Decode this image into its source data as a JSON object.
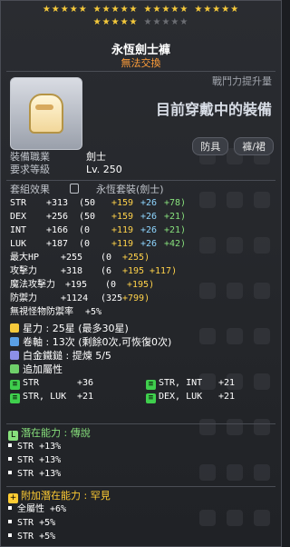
{
  "header": {
    "title": "永恆劍士褲",
    "subtitle": "無法交換",
    "power_label": "戰鬥力提升量",
    "wearing_label": "目前穿戴中的裝備",
    "tags": [
      "防具",
      "褲/裙"
    ]
  },
  "stars": {
    "filled": 25,
    "max": 30
  },
  "info": [
    {
      "key": "裝備職業",
      "value": "劍士"
    },
    {
      "key": "要求等級",
      "value": "Lv. 250"
    }
  ],
  "set": {
    "label": "套組效果",
    "name": "永恆套裝(劍士)"
  },
  "stats": [
    {
      "name": "STR",
      "total": "+313",
      "base": "(50",
      "star": "+159",
      "pot": "+26",
      "flame": "+78)"
    },
    {
      "name": "DEX",
      "total": "+256",
      "base": "(50",
      "star": "+159",
      "pot": "+26",
      "flame": "+21)"
    },
    {
      "name": "INT",
      "total": "+166",
      "base": "(0",
      "star": "+119",
      "pot": "+26",
      "flame": "+21)"
    },
    {
      "name": "LUK",
      "total": "+187",
      "base": "(0",
      "star": "+119",
      "pot": "+26",
      "flame": "+42)"
    }
  ],
  "stats2": [
    {
      "name": "最大HP",
      "total": "+255",
      "detail_a": "(0",
      "detail_b": "+255)"
    },
    {
      "name": "攻擊力",
      "total": "+318",
      "detail_a": "(6",
      "detail_b": "+195",
      "detail_c": "+117)"
    },
    {
      "name": "魔法攻擊力",
      "total": "+195",
      "detail_a": "(0",
      "detail_b": "+195)"
    },
    {
      "name": "防禦力",
      "total": "+1124",
      "detail_a": "(325",
      "detail_b": "+799)"
    },
    {
      "name": "無視怪物防禦率",
      "total": "+5%"
    }
  ],
  "enhance": [
    {
      "icon": "star-icon",
      "text": "星力 : 25星 (最多30星)"
    },
    {
      "icon": "scroll-icon",
      "text": "卷軸 : 13次 (剩餘0次,可恢復0次)"
    },
    {
      "icon": "hammer-icon",
      "text": "白金鐵鎚 : 提煉 5/5"
    },
    {
      "icon": "leaf-icon",
      "text": "追加屬性"
    }
  ],
  "additional_attrs": [
    {
      "label": "STR",
      "value": "+36"
    },
    {
      "label": "STR, INT",
      "value": "+21"
    },
    {
      "label": "STR, LUK",
      "value": "+21"
    },
    {
      "label": "DEX, LUK",
      "value": "+21"
    }
  ],
  "potential": {
    "title": "潛在能力 : 傳說",
    "lines": [
      "STR +13%",
      "STR +13%",
      "STR +13%"
    ]
  },
  "bonus_potential": {
    "title": "附加潛在能力 : 罕見",
    "lines": [
      "全屬性 +6%",
      "STR +5%",
      "STR +5%"
    ]
  }
}
